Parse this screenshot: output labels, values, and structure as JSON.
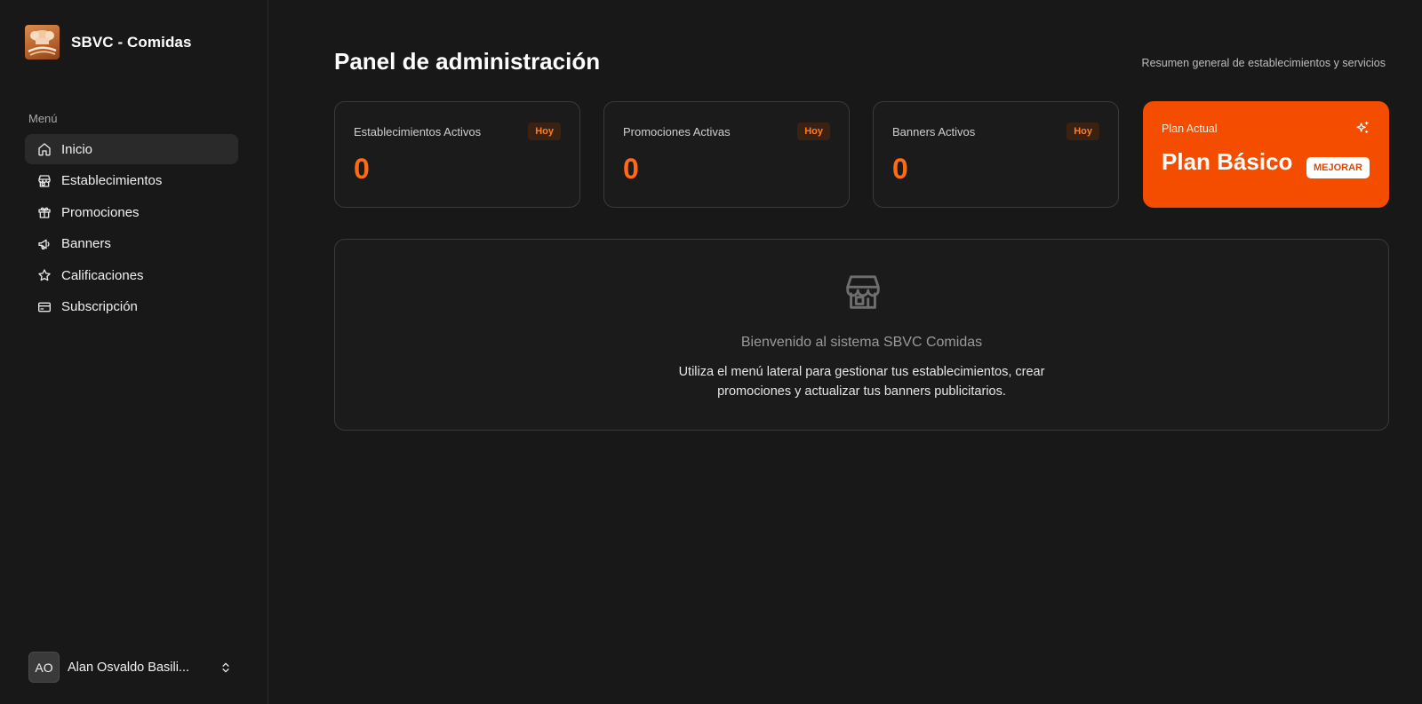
{
  "brand": {
    "name": "SBVC - Comidas",
    "logo_icon": "chef-hat-logo"
  },
  "sidebar": {
    "menu_label": "Menú",
    "items": [
      {
        "label": "Inicio",
        "icon": "home-icon",
        "active": true
      },
      {
        "label": "Establecimientos",
        "icon": "store-icon",
        "active": false
      },
      {
        "label": "Promociones",
        "icon": "gift-icon",
        "active": false
      },
      {
        "label": "Banners",
        "icon": "megaphone-icon",
        "active": false
      },
      {
        "label": "Calificaciones",
        "icon": "star-icon",
        "active": false
      },
      {
        "label": "Subscripción",
        "icon": "credit-card-icon",
        "active": false
      }
    ],
    "user": {
      "initials": "AO",
      "name": "Alan Osvaldo Basili..."
    }
  },
  "header": {
    "title": "Panel de administración",
    "subtitle": "Resumen general de establecimientos y servicios"
  },
  "stats": [
    {
      "label": "Establecimientos Activos",
      "badge": "Hoy",
      "value": "0"
    },
    {
      "label": "Promociones Activas",
      "badge": "Hoy",
      "value": "0"
    },
    {
      "label": "Banners Activos",
      "badge": "Hoy",
      "value": "0"
    }
  ],
  "plan": {
    "label": "Plan Actual",
    "name": "Plan Básico",
    "upgrade_label": "MEJORAR",
    "icon": "sparkles-icon"
  },
  "welcome": {
    "icon": "store-icon",
    "title": "Bienvenido al sistema SBVC Comidas",
    "text": "Utiliza el menú lateral para gestionar tus establecimientos, crear promociones y actualizar tus banners publicitarios."
  },
  "colors": {
    "background": "#181818",
    "accent": "#f44d00",
    "stat_value": "#ff6a13",
    "badge_bg": "#3a2213"
  }
}
